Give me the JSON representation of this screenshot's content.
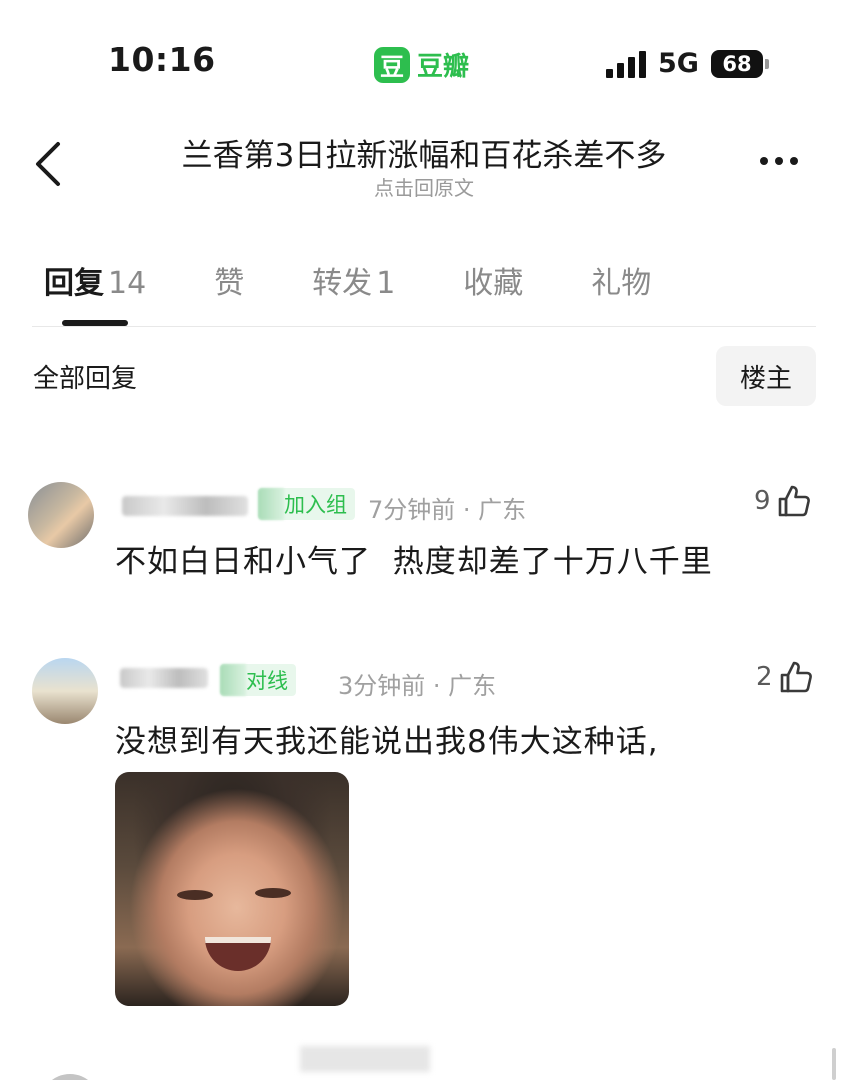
{
  "status_bar": {
    "time": "10:16",
    "app_logo_char": "豆",
    "app_name": "豆瓣",
    "network": "5G",
    "battery": "68"
  },
  "header": {
    "title": "兰香第3日拉新涨幅和百花杀差不多",
    "subtitle": "点击回原文",
    "back_icon": "chevron-left-icon",
    "more_icon": "more-dots-icon"
  },
  "tabs": [
    {
      "label": "回复",
      "count": "14",
      "active": true
    },
    {
      "label": "赞",
      "count": "",
      "active": false
    },
    {
      "label": "转发",
      "count": "1",
      "active": false
    },
    {
      "label": "收藏",
      "count": "",
      "active": false
    },
    {
      "label": "礼物",
      "count": "",
      "active": false
    }
  ],
  "filter": {
    "all_label": "全部回复",
    "op_label": "楼主"
  },
  "comments": [
    {
      "group_tag": "加入组",
      "time": "7分钟前",
      "location": "广东",
      "likes": "9",
      "text": "不如白日和小气了  热度却差了十万八千里"
    },
    {
      "group_tag": "对线",
      "time": "3分钟前",
      "location": "广东",
      "likes": "2",
      "text": "没想到有天我还能说出我8伟大这种话,",
      "has_image": true
    }
  ],
  "colors": {
    "brand_green": "#2dbe4e",
    "text_primary": "#1a1a1a",
    "text_secondary": "#a0a0a0"
  }
}
